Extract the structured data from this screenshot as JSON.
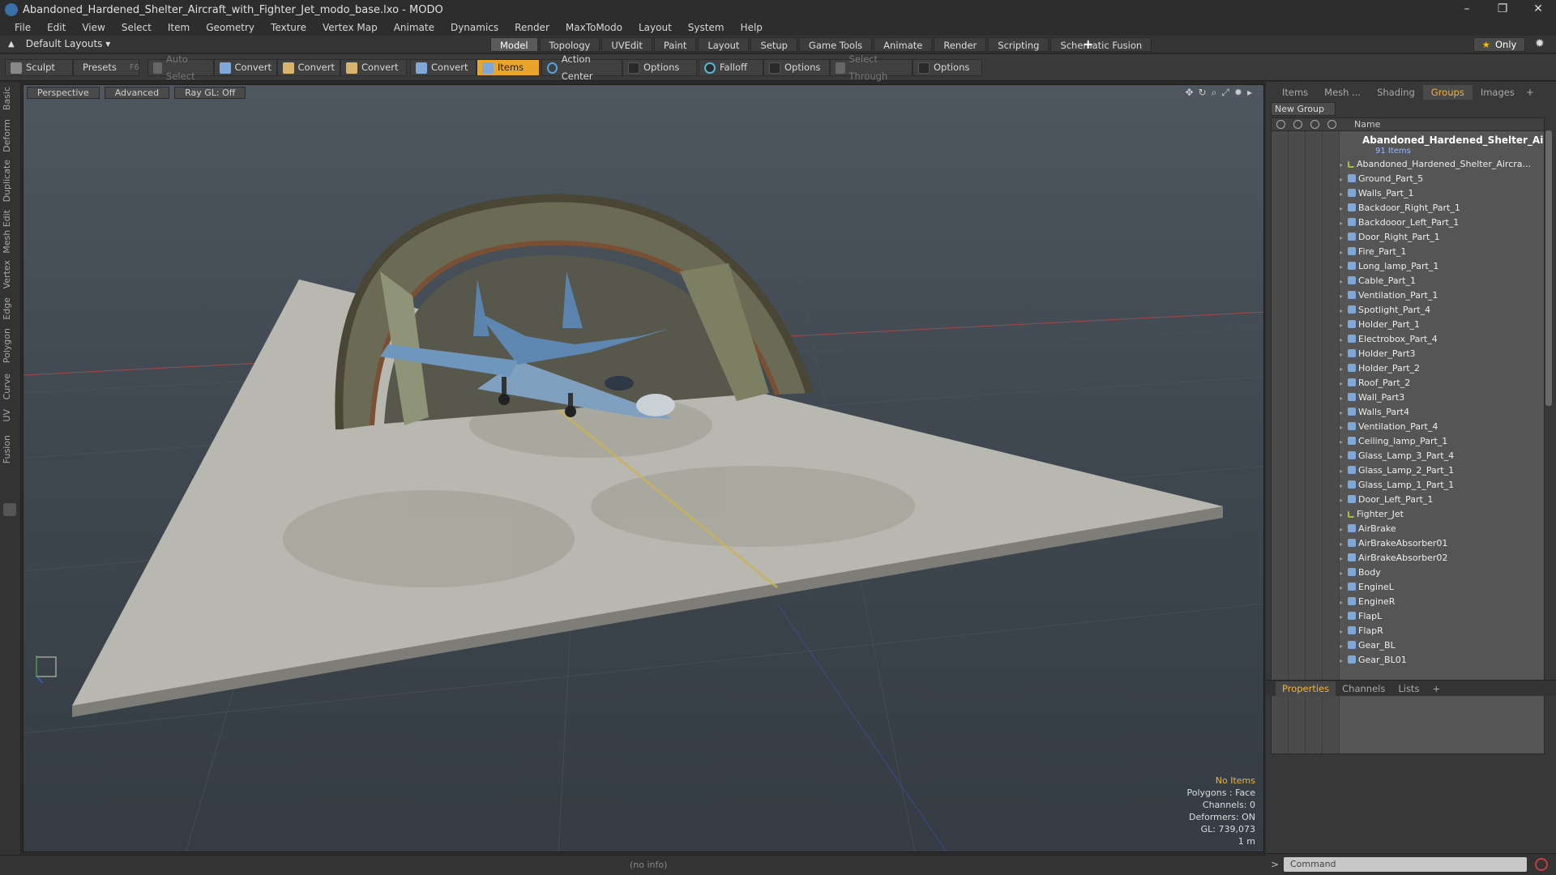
{
  "window": {
    "title": "Abandoned_Hardened_Shelter_Aircraft_with_Fighter_Jet_modo_base.lxo - MODO",
    "controls": [
      "–",
      "❐",
      "✕"
    ]
  },
  "menu": [
    "File",
    "Edit",
    "View",
    "Select",
    "Item",
    "Geometry",
    "Texture",
    "Vertex Map",
    "Animate",
    "Dynamics",
    "Render",
    "MaxToModo",
    "Layout",
    "System",
    "Help"
  ],
  "layout_bar": {
    "layout_selector": "Default Layouts ▾",
    "tabs": [
      "Model",
      "Topology",
      "UVEdit",
      "Paint",
      "Layout",
      "Setup",
      "Game Tools",
      "Animate",
      "Render",
      "Scripting",
      "Schematic Fusion"
    ],
    "active_tab": "Model",
    "plus": "+",
    "only_label": "Only"
  },
  "toolbar": {
    "sculpt": "Sculpt",
    "presets": "Presets",
    "presets_key": "F6",
    "auto_select": "Auto Select",
    "convert1": "Convert",
    "convert2": "Convert",
    "convert3": "Convert",
    "convert4": "Convert",
    "items": "Items",
    "action_center": "Action Center",
    "options1": "Options",
    "falloff": "Falloff",
    "options2": "Options",
    "select_through": "Select Through",
    "options3": "Options"
  },
  "left_tabs": [
    "Basic",
    "Deform",
    "Duplicate",
    "Mesh Edit",
    "Vertex",
    "Edge",
    "Polygon",
    "Curve",
    "UV",
    "Fusion"
  ],
  "viewport": {
    "view_mode": "Perspective",
    "shading": "Advanced",
    "raygl": "Ray GL: Off",
    "info": {
      "selection": "No Items",
      "polygons": "Polygons : Face",
      "channels": "Channels: 0",
      "deformers": "Deformers: ON",
      "gl": "GL: 739,073",
      "scale": "1 m"
    }
  },
  "right_panel": {
    "tabs": [
      "Items",
      "Mesh ...",
      "Shading",
      "Groups",
      "Images"
    ],
    "active_tab": "Groups",
    "new_group": "New Group",
    "column_name": "Name",
    "root": "Abandoned_Hardened_Shelter_Ai ...",
    "root_count": "91 Items",
    "items": [
      {
        "label": "Abandoned_Hardened_Shelter_Aircra...",
        "kind": "locator"
      },
      {
        "label": "Ground_Part_5",
        "kind": "mesh"
      },
      {
        "label": "Walls_Part_1",
        "kind": "mesh"
      },
      {
        "label": "Backdoor_Right_Part_1",
        "kind": "mesh"
      },
      {
        "label": "Backdooor_Left_Part_1",
        "kind": "mesh"
      },
      {
        "label": "Door_Right_Part_1",
        "kind": "mesh"
      },
      {
        "label": "Fire_Part_1",
        "kind": "mesh"
      },
      {
        "label": "Long_lamp_Part_1",
        "kind": "mesh"
      },
      {
        "label": "Cable_Part_1",
        "kind": "mesh"
      },
      {
        "label": "Ventilation_Part_1",
        "kind": "mesh"
      },
      {
        "label": "Spotlight_Part_4",
        "kind": "mesh"
      },
      {
        "label": "Holder_Part_1",
        "kind": "mesh"
      },
      {
        "label": "Electrobox_Part_4",
        "kind": "mesh"
      },
      {
        "label": "Holder_Part3",
        "kind": "mesh"
      },
      {
        "label": "Holder_Part_2",
        "kind": "mesh"
      },
      {
        "label": "Roof_Part_2",
        "kind": "mesh"
      },
      {
        "label": "Wall_Part3",
        "kind": "mesh"
      },
      {
        "label": "Walls_Part4",
        "kind": "mesh"
      },
      {
        "label": "Ventilation_Part_4",
        "kind": "mesh"
      },
      {
        "label": "Ceiling_lamp_Part_1",
        "kind": "mesh"
      },
      {
        "label": "Glass_Lamp_3_Part_4",
        "kind": "mesh"
      },
      {
        "label": "Glass_Lamp_2_Part_1",
        "kind": "mesh"
      },
      {
        "label": "Glass_Lamp_1_Part_1",
        "kind": "mesh"
      },
      {
        "label": "Door_Left_Part_1",
        "kind": "mesh"
      },
      {
        "label": "Fighter_Jet",
        "kind": "locator"
      },
      {
        "label": "AirBrake",
        "kind": "mesh"
      },
      {
        "label": "AirBrakeAbsorber01",
        "kind": "mesh"
      },
      {
        "label": "AirBrakeAbsorber02",
        "kind": "mesh"
      },
      {
        "label": "Body",
        "kind": "mesh"
      },
      {
        "label": "EngineL",
        "kind": "mesh"
      },
      {
        "label": "EngineR",
        "kind": "mesh"
      },
      {
        "label": "FlapL",
        "kind": "mesh"
      },
      {
        "label": "FlapR",
        "kind": "mesh"
      },
      {
        "label": "Gear_BL",
        "kind": "mesh"
      },
      {
        "label": "Gear_BL01",
        "kind": "mesh"
      }
    ],
    "props_tabs": [
      "Properties",
      "Channels",
      "Lists"
    ],
    "props_active": "Properties"
  },
  "status": {
    "info": "(no info)",
    "command_placeholder": "Command",
    "prompt": ">"
  },
  "colors": {
    "accent": "#f0b33a",
    "active_tool": "#e8a52a",
    "viewport_bg": "#3f4850"
  }
}
